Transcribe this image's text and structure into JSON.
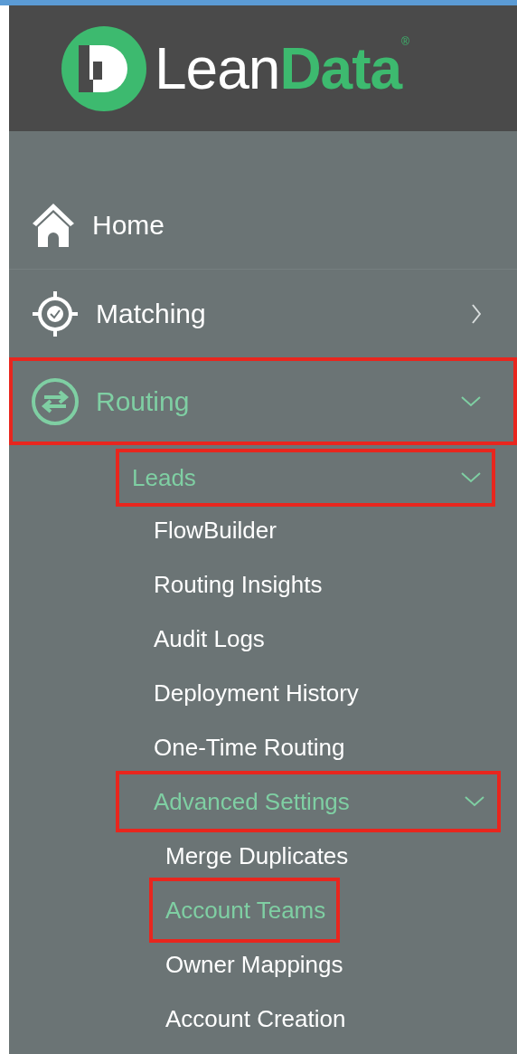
{
  "logo": {
    "word_light": "Lean",
    "word_bold": "Data",
    "trademark": "®"
  },
  "nav": [
    {
      "label": "Home",
      "kind": "home",
      "selected": false,
      "highlighted": false
    },
    {
      "label": "Matching",
      "kind": "target",
      "selected": false,
      "expanded": false,
      "highlighted": false
    },
    {
      "label": "Routing",
      "kind": "routing",
      "selected": true,
      "expanded": true,
      "highlighted": true,
      "children": [
        {
          "label": "Leads",
          "selected": true,
          "expanded": true,
          "highlighted": true,
          "children": [
            {
              "label": "FlowBuilder",
              "selected": false,
              "highlighted": false
            },
            {
              "label": "Routing Insights",
              "selected": false,
              "highlighted": false
            },
            {
              "label": "Audit Logs",
              "selected": false,
              "highlighted": false
            },
            {
              "label": "Deployment History",
              "selected": false,
              "highlighted": false
            },
            {
              "label": "One-Time Routing",
              "selected": false,
              "highlighted": false
            },
            {
              "label": "Advanced Settings",
              "selected": true,
              "expanded": true,
              "highlighted": true,
              "children": [
                {
                  "label": "Merge Duplicates",
                  "selected": false,
                  "highlighted": false
                },
                {
                  "label": "Account Teams",
                  "selected": true,
                  "highlighted": true
                },
                {
                  "label": "Owner Mappings",
                  "selected": false,
                  "highlighted": false
                },
                {
                  "label": "Account Creation",
                  "selected": false,
                  "highlighted": false
                }
              ]
            }
          ]
        }
      ]
    }
  ]
}
